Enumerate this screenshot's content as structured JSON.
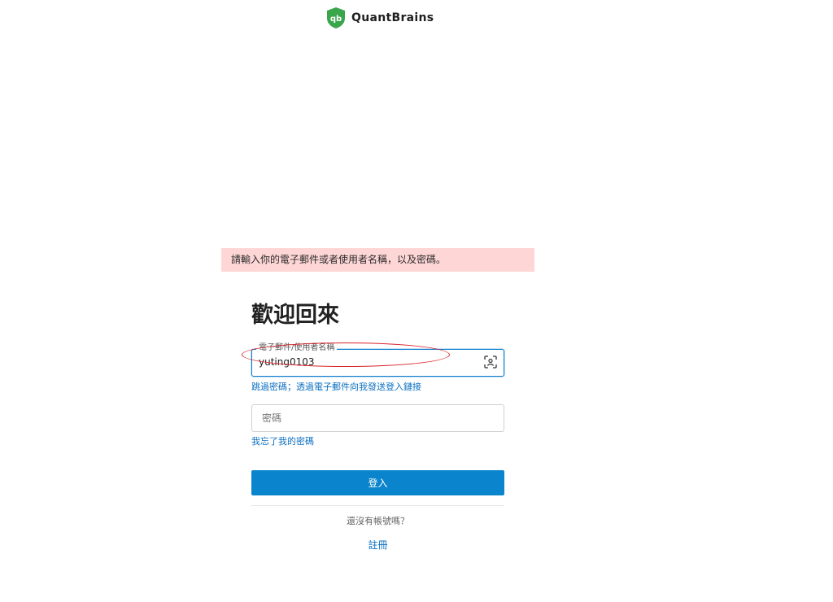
{
  "brand": {
    "name": "QuantBrains",
    "logo_text": "qb",
    "logo_color": "#3aa64b"
  },
  "error_banner": {
    "message": "請輸入你的電子郵件或者使用者名稱，以及密碼。",
    "background": "#ffd6d6"
  },
  "form": {
    "heading": "歡迎回來",
    "email_field": {
      "label": "電子郵件/使用者名稱",
      "value": "yuting0103",
      "icon": "face-id-icon"
    },
    "magic_link": "跳過密碼；透過電子郵件向我發送登入鏈接",
    "password_field": {
      "placeholder": "密碼"
    },
    "forgot_password": "我忘了我的密碼",
    "submit_label": "登入",
    "no_account_text": "還沒有帳號嗎？",
    "register_label": "註冊"
  },
  "colors": {
    "accent": "#0a84cc",
    "link": "#0b6fc1",
    "annotation": "#d8232a"
  }
}
